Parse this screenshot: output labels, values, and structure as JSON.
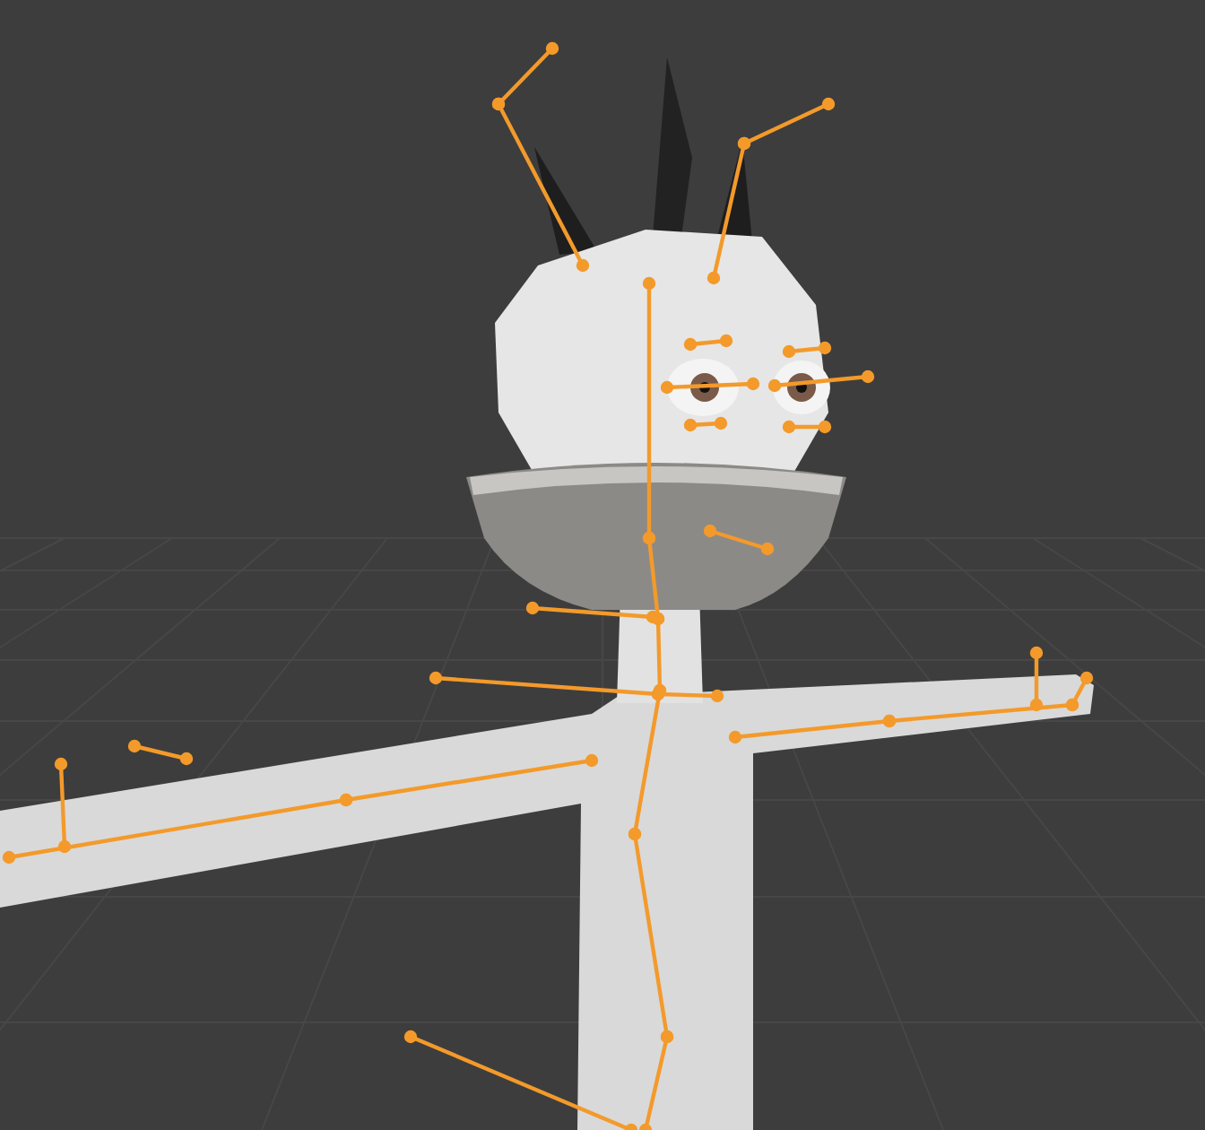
{
  "viewport": {
    "show_grid": true,
    "show_bones": true
  }
}
